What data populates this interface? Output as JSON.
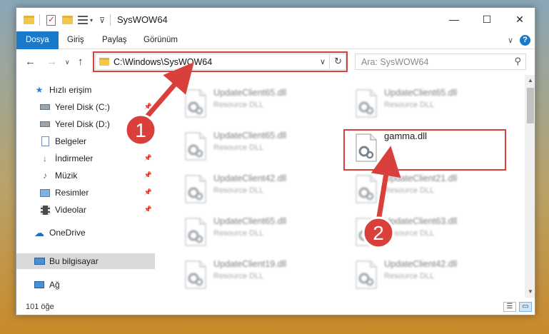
{
  "window": {
    "title": "SysWOW64",
    "controls": {
      "minimize": "—",
      "maximize": "☐",
      "close": "✕"
    }
  },
  "ribbon": {
    "tabs": [
      {
        "label": "Dosya",
        "active": true
      },
      {
        "label": "Giriş"
      },
      {
        "label": "Paylaş"
      },
      {
        "label": "Görünüm"
      }
    ]
  },
  "navbar": {
    "address": "C:\\Windows\\SysWOW64",
    "search_placeholder": "Ara: SysWOW64"
  },
  "sidebar": {
    "items": [
      {
        "label": "Hızlı erişim",
        "icon": "star-icon"
      },
      {
        "label": "Yerel Disk (C:)",
        "icon": "drive-icon",
        "pinned": true
      },
      {
        "label": "Yerel Disk (D:)",
        "icon": "drive-icon",
        "pinned": true
      },
      {
        "label": "Belgeler",
        "icon": "document-icon",
        "pinned": true
      },
      {
        "label": "İndirmeler",
        "icon": "download-icon",
        "pinned": true
      },
      {
        "label": "Müzik",
        "icon": "music-icon",
        "pinned": true
      },
      {
        "label": "Resimler",
        "icon": "pictures-icon",
        "pinned": true
      },
      {
        "label": "Videolar",
        "icon": "video-icon",
        "pinned": true
      },
      {
        "label": "OneDrive",
        "icon": "cloud-icon"
      },
      {
        "label": "Bu bilgisayar",
        "icon": "computer-icon",
        "selected": true
      },
      {
        "label": "Ağ",
        "icon": "network-icon"
      }
    ]
  },
  "files": [
    {
      "name": "UpdateClient65.dll",
      "type": "Resource DLL"
    },
    {
      "name": "UpdateClient65.dll",
      "type": "Resource DLL"
    },
    {
      "name": "UpdateClient65.dll",
      "type": "Resource DLL"
    },
    {
      "name": "gamma.dll",
      "type": ""
    },
    {
      "name": "UpdateClient42.dll",
      "type": "Resource DLL"
    },
    {
      "name": "UpdateClient21.dll",
      "type": "Resource DLL"
    },
    {
      "name": "UpdateClient65.dll",
      "type": "Resource DLL"
    },
    {
      "name": "UpdateClient63.dll",
      "type": "Resource DLL"
    },
    {
      "name": "UpdateClient19.dll",
      "type": "Resource DLL"
    },
    {
      "name": "UpdateClient42.dll",
      "type": "Resource DLL"
    }
  ],
  "status": {
    "count": "101 öğe"
  },
  "annotations": {
    "badge1": "1",
    "badge2": "2",
    "color": "#d9403b"
  }
}
